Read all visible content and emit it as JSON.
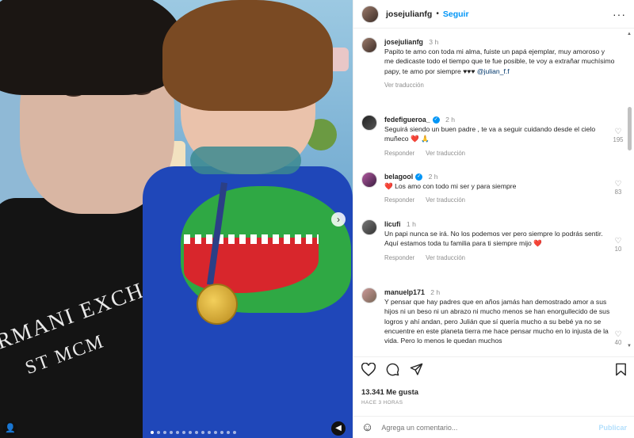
{
  "post": {
    "username": "josejulianfg",
    "follow_label": "Seguir",
    "separator": "•",
    "more_label": "···"
  },
  "caption": {
    "username": "josejulianfg",
    "time": "3 h",
    "text_before_mention": "Papito te amo con toda mi alma, fuiste un papá ejemplar, muy amoroso y me dedicaste todo el tiempo que te fue posible, te voy a extrañar muchísimo papy, te amo por siempre ♥♥♥ ",
    "mention": "@julian_f.f",
    "translate": "Ver traducción"
  },
  "comments": [
    {
      "username": "fedefigueroa_",
      "verified": true,
      "time": "2 h",
      "text": "Seguirá siendo un buen padre , te va a seguir cuidando desde el cielo muñeco ❤️ 🙏",
      "reply": "Responder",
      "translate": "Ver traducción",
      "likes": "195"
    },
    {
      "username": "belagool",
      "verified": true,
      "time": "2 h",
      "text": "❤️ Los amo con todo mi ser y para siempre",
      "reply": "Responder",
      "translate": "Ver traducción",
      "likes": "83"
    },
    {
      "username": "licufi",
      "verified": false,
      "time": "1 h",
      "text": "Un papi nunca se irá. No los podemos ver pero siempre lo podrás sentir. Aquí estamos toda tu familia para ti siempre mijo ❤️",
      "reply": "Responder",
      "translate": "Ver traducción",
      "likes": "10"
    },
    {
      "username": "manuelp171",
      "verified": false,
      "time": "2 h",
      "text": "Y pensar que hay padres que en años jamás han demostrado amor a sus hijos ni un beso ni un abrazo ni mucho menos se han enorgullecido de sus logros y ahí andan, pero Julián que sí quería mucho a su bebé ya no se encuentre en este planeta tierra me hace pensar mucho en lo injusta de la vida. Pero lo menos le quedan muchos",
      "likes": "40"
    }
  ],
  "photo": {
    "shirt_text_1": "RMANI EXCHA",
    "shirt_text_2": "ST MCM",
    "carousel_dots": 14,
    "active_dot": 0
  },
  "actions": {
    "like_icon": "heart-icon",
    "comment_icon": "comment-icon",
    "share_icon": "share-icon",
    "save_icon": "bookmark-icon"
  },
  "likes_text": "13.341 Me gusta",
  "date_text": "HACE 3 HORAS",
  "add_comment": {
    "emoji_icon": "smiley-icon",
    "placeholder": "Agrega un comentario...",
    "publish_label": "Publicar"
  },
  "colors": {
    "accent": "#0095f6",
    "publish_disabled": "#b2dffc",
    "heart": "#ed4956"
  }
}
